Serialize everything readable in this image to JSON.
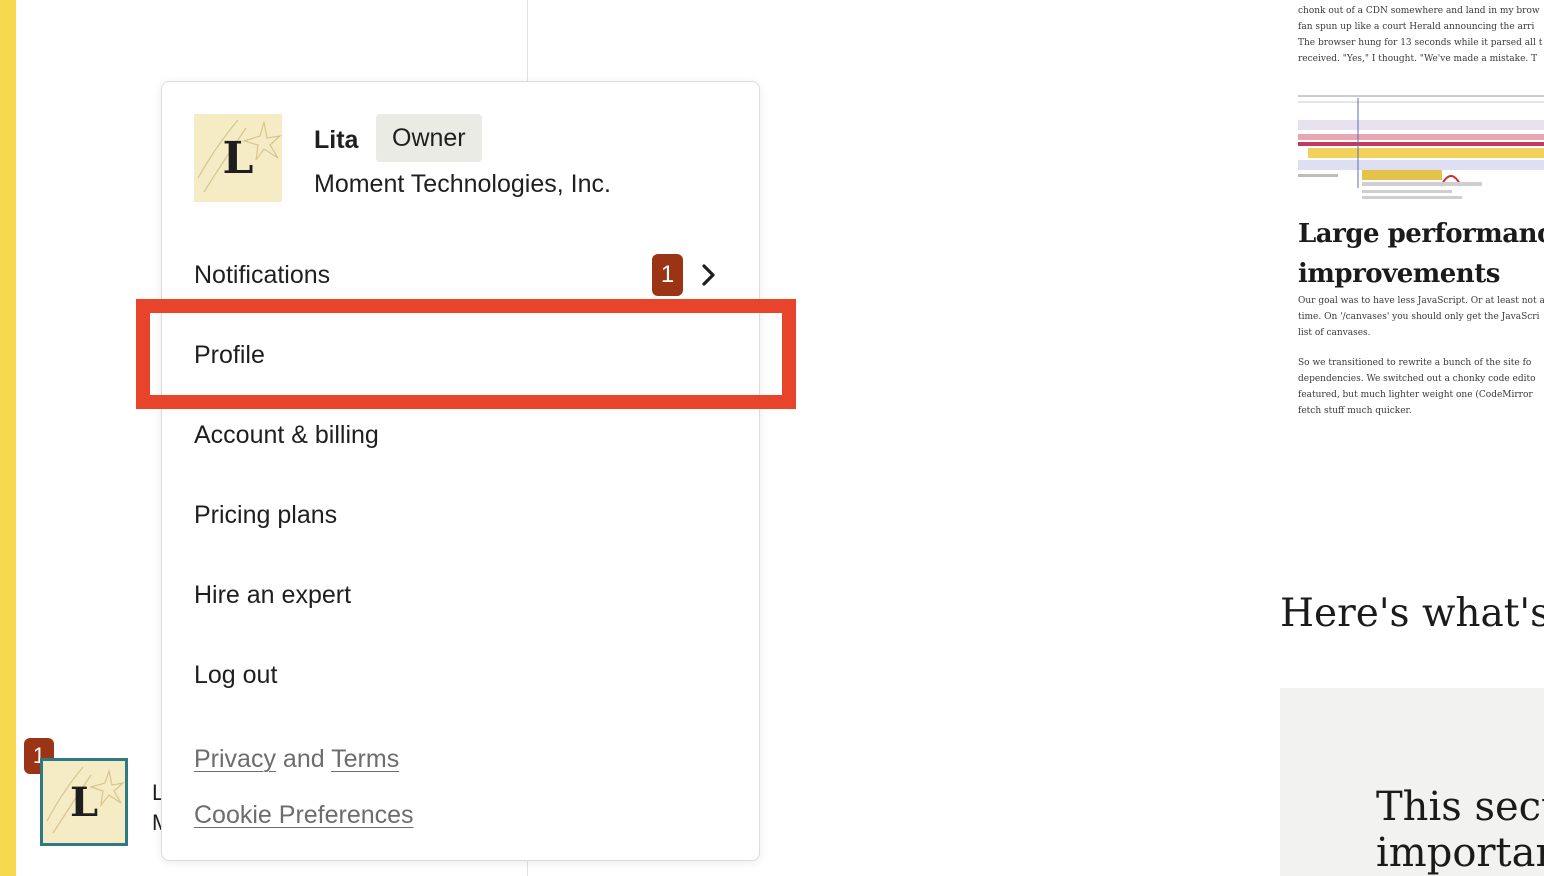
{
  "account": {
    "avatar_letter": "L",
    "notification_count": "1",
    "name_peek": "L",
    "org_peek": "M"
  },
  "menu": {
    "avatar_letter": "L",
    "user_name": "Lita",
    "role_badge": "Owner",
    "org_name": "Moment Technologies, Inc.",
    "items": [
      {
        "label": "Notifications",
        "badge": "1"
      },
      {
        "label": "Profile"
      },
      {
        "label": "Account & billing"
      },
      {
        "label": "Pricing plans"
      },
      {
        "label": "Hire an expert"
      },
      {
        "label": "Log out"
      }
    ],
    "footer": {
      "privacy": "Privacy",
      "and": "and",
      "terms": "Terms",
      "cookies": "Cookie Preferences"
    }
  },
  "content": {
    "thumb_lines_top": [
      "chonk out of a CDN somewhere and land in my brow",
      "fan spun up like a court Herald announcing the arri",
      "The browser hung for 13 seconds while it parsed all t",
      "received. \"Yes,\" I thought. \"We've made a mistake. T"
    ],
    "thumb_heading_1": "Large performance",
    "thumb_heading_2": "improvements",
    "thumb_lines_mid": [
      "Our goal was to have less JavaScript. Or at least not al",
      "time. On '/canvases' you should only get the JavaScri",
      "list of canvases."
    ],
    "thumb_lines_bottom": [
      "So we transitioned to rewrite a bunch of the site fo",
      "dependencies. We switched out a chonky code edito",
      "featured, but much lighter weight one (CodeMirror",
      "fetch stuff much quicker."
    ],
    "section_heading": "Here's what's h",
    "panel_line_1": "This secti",
    "panel_line_2": "importan"
  },
  "colors": {
    "accent_yellow": "#f6d94f",
    "badge": "#9b3414",
    "highlight": "#e8432b",
    "account_border": "#2f7a80",
    "avatar_bg": "#f5ecc6"
  },
  "icons": [
    "sparkle-icon",
    "chevron-right-icon"
  ]
}
